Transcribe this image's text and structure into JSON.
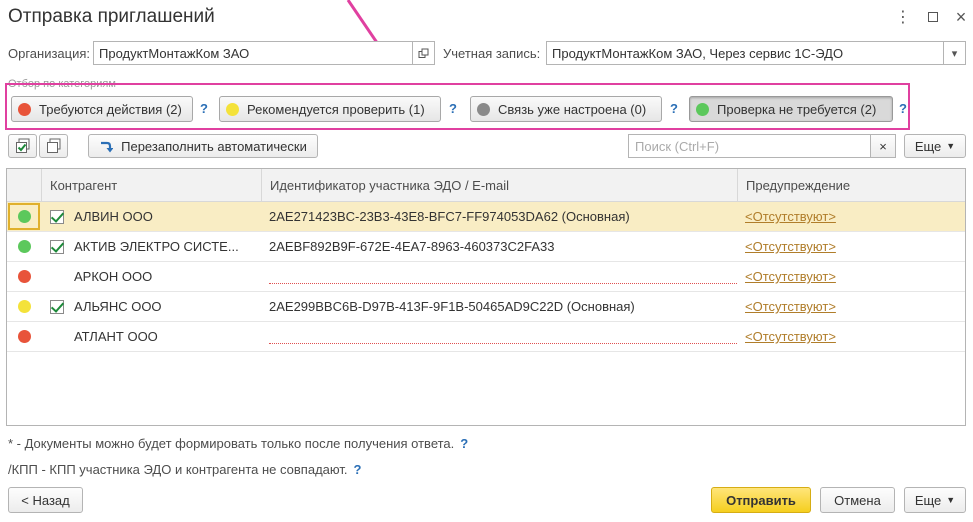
{
  "window": {
    "title": "Отправка приглашений",
    "more_icon": "vertical-dots-icon",
    "maximize_icon": "square-icon",
    "close_icon": "close-icon"
  },
  "org": {
    "label": "Организация:",
    "value": "ПродуктМонтажКом ЗАО"
  },
  "account": {
    "label": "Учетная запись:",
    "value": "ПродуктМонтажКом ЗАО, Через сервис 1С-ЭДО"
  },
  "filter": {
    "caption": "Отбор по категориям",
    "help": "?",
    "chips": [
      {
        "label": "Требуются действия (2)",
        "color": "#e8543a"
      },
      {
        "label": "Рекомендуется проверить (1)",
        "color": "#f4e23a"
      },
      {
        "label": "Связь уже настроена (0)",
        "color": "#8a8a8a"
      },
      {
        "label": "Проверка не требуется (2)",
        "color": "#5cc85c"
      }
    ]
  },
  "toolbar": {
    "refill_label": "Перезаполнить автоматически",
    "search_placeholder": "Поиск (Ctrl+F)",
    "clear_label": "×",
    "more_label": "Еще"
  },
  "table": {
    "columns": [
      "Контрагент",
      "Идентификатор участника ЭДО / E-mail",
      "Предупреждение"
    ],
    "rows": [
      {
        "status_color": "#5cc85c",
        "checked": true,
        "name": "АЛВИН ООО",
        "ident": "2AE271423BC-23B3-43E8-BFC7-FF974053DA62 (Основная)",
        "warning": "<Отсутствуют>"
      },
      {
        "status_color": "#5cc85c",
        "checked": true,
        "name": "АКТИВ ЭЛЕКТРО СИСТЕ...",
        "ident": "2AEBF892B9F-672E-4EA7-8963-460373C2FA33",
        "warning": "<Отсутствуют>"
      },
      {
        "status_color": "#e8543a",
        "checked": false,
        "name": "АРКОН ООО",
        "ident": "",
        "warning": "<Отсутствуют>"
      },
      {
        "status_color": "#f4e23a",
        "checked": true,
        "name": "АЛЬЯНС ООО",
        "ident": "2AE299BBC6B-D97B-413F-9F1B-50465AD9C22D (Основная)",
        "warning": "<Отсутствуют>"
      },
      {
        "status_color": "#e8543a",
        "checked": false,
        "name": "АТЛАНТ ООО",
        "ident": "",
        "warning": "<Отсутствуют>"
      }
    ]
  },
  "notes": {
    "line1": "* - Документы можно будет формировать только после получения ответа.",
    "line2": "/КПП - КПП участника ЭДО и контрагента не совпадают.",
    "help": "?"
  },
  "footer": {
    "back_label": "< Назад",
    "send_label": "Отправить",
    "cancel_label": "Отмена",
    "more_label": "Еще"
  },
  "colors": {
    "accent": "#f5cf1f",
    "highlight_frame": "#e040a0",
    "link": "#b07d2a"
  }
}
